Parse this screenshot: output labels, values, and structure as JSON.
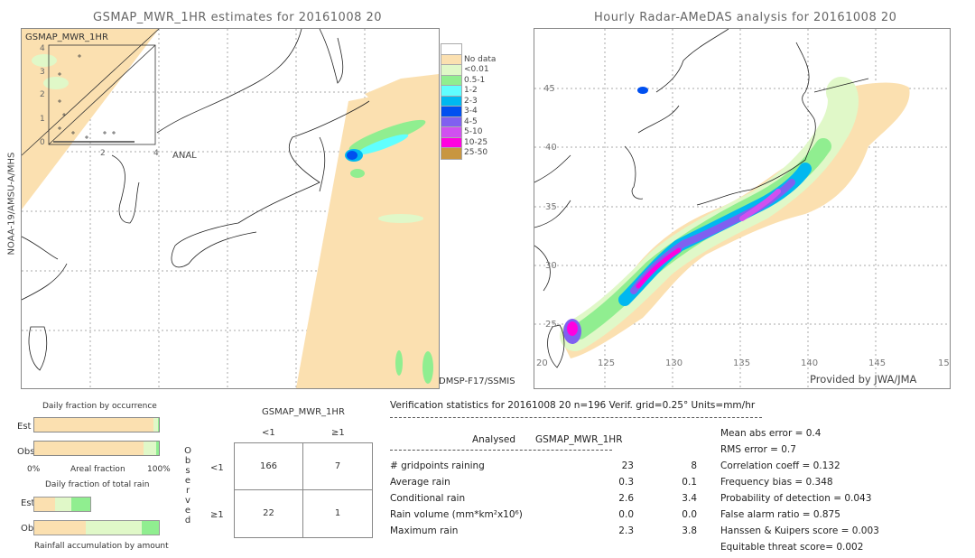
{
  "left_map": {
    "title": "GSMAP_MWR_1HR estimates for 20161008 20",
    "inset_label": "GSMAP_MWR_1HR",
    "inset_ticks": [
      "0",
      "1",
      "2",
      "3",
      "4"
    ],
    "inset_xlabel": "ANAL",
    "ylabel": "NOAA-19/AMSU-A/MHS",
    "sensor_label": "DMSP-F17/SSMIS"
  },
  "legend": {
    "items": [
      {
        "label": "",
        "color": "#ffffff"
      },
      {
        "label": "No data",
        "color": "#fbe0b0"
      },
      {
        "label": "<0.01",
        "color": "#e0f8c8"
      },
      {
        "label": "0.5-1",
        "color": "#90ee90"
      },
      {
        "label": "1-2",
        "color": "#60ffff"
      },
      {
        "label": "2-3",
        "color": "#00b8f0"
      },
      {
        "label": "3-4",
        "color": "#0050f0"
      },
      {
        "label": "4-5",
        "color": "#8060f0"
      },
      {
        "label": "5-10",
        "color": "#d050f0"
      },
      {
        "label": "10-25",
        "color": "#ff00e0"
      },
      {
        "label": "25-50",
        "color": "#c89640"
      }
    ]
  },
  "right_map": {
    "title": "Hourly Radar-AMeDAS analysis for 20161008 20",
    "lat_ticks": [
      "45",
      "40",
      "35",
      "30",
      "25",
      "20"
    ],
    "lon_ticks": [
      "125",
      "130",
      "135",
      "140",
      "145",
      "15"
    ],
    "credit": "Provided by JWA/JMA"
  },
  "occurrence": {
    "title": "Daily fraction by occurrence",
    "est_label": "Est",
    "obs_label": "Obs",
    "axis_left": "0%",
    "axis_mid": "Areal fraction",
    "axis_right": "100%",
    "est_fractions": [
      0.96,
      0.03,
      0.01
    ],
    "obs_fractions": [
      0.88,
      0.1,
      0.02
    ]
  },
  "total_rain": {
    "title": "Daily fraction of total rain",
    "est_label": "Est",
    "obs_label": "Obs",
    "footer": "Rainfall accumulation by amount",
    "est_fractions": [
      0.17,
      0.13,
      0.15
    ],
    "obs_fractions": [
      0.41,
      0.45,
      0.14
    ]
  },
  "contingency": {
    "title": "GSMAP_MWR_1HR",
    "col_headers": [
      "<1",
      "≥1"
    ],
    "row_headers": [
      "<1",
      "≥1"
    ],
    "side_label": [
      "O",
      "b",
      "s",
      "e",
      "r",
      "v",
      "e",
      "d"
    ],
    "cells": [
      [
        "166",
        "7"
      ],
      [
        "22",
        "1"
      ]
    ]
  },
  "stats": {
    "header": "Verification statistics for 20161008 20   n=196   Verif. grid=0.25°   Units=mm/hr",
    "col_analysed": "Analysed",
    "col_gsmap": "GSMAP_MWR_1HR",
    "rows": [
      {
        "label": "# gridpoints raining",
        "a": "23",
        "g": "8"
      },
      {
        "label": "Average rain",
        "a": "0.3",
        "g": "0.1"
      },
      {
        "label": "Conditional rain",
        "a": "2.6",
        "g": "3.4"
      },
      {
        "label": "Rain volume (mm*km²x10⁶)",
        "a": "0.0",
        "g": "0.0"
      },
      {
        "label": "Maximum rain",
        "a": "2.3",
        "g": "3.8"
      }
    ],
    "scores": [
      "Mean abs error = 0.4",
      "RMS error = 0.7",
      "Correlation coeff = 0.132",
      "Frequency bias = 0.348",
      "Probability of detection = 0.043",
      "False alarm ratio = 0.875",
      "Hanssen & Kuipers score = 0.003",
      "Equitable threat score= 0.002"
    ]
  }
}
